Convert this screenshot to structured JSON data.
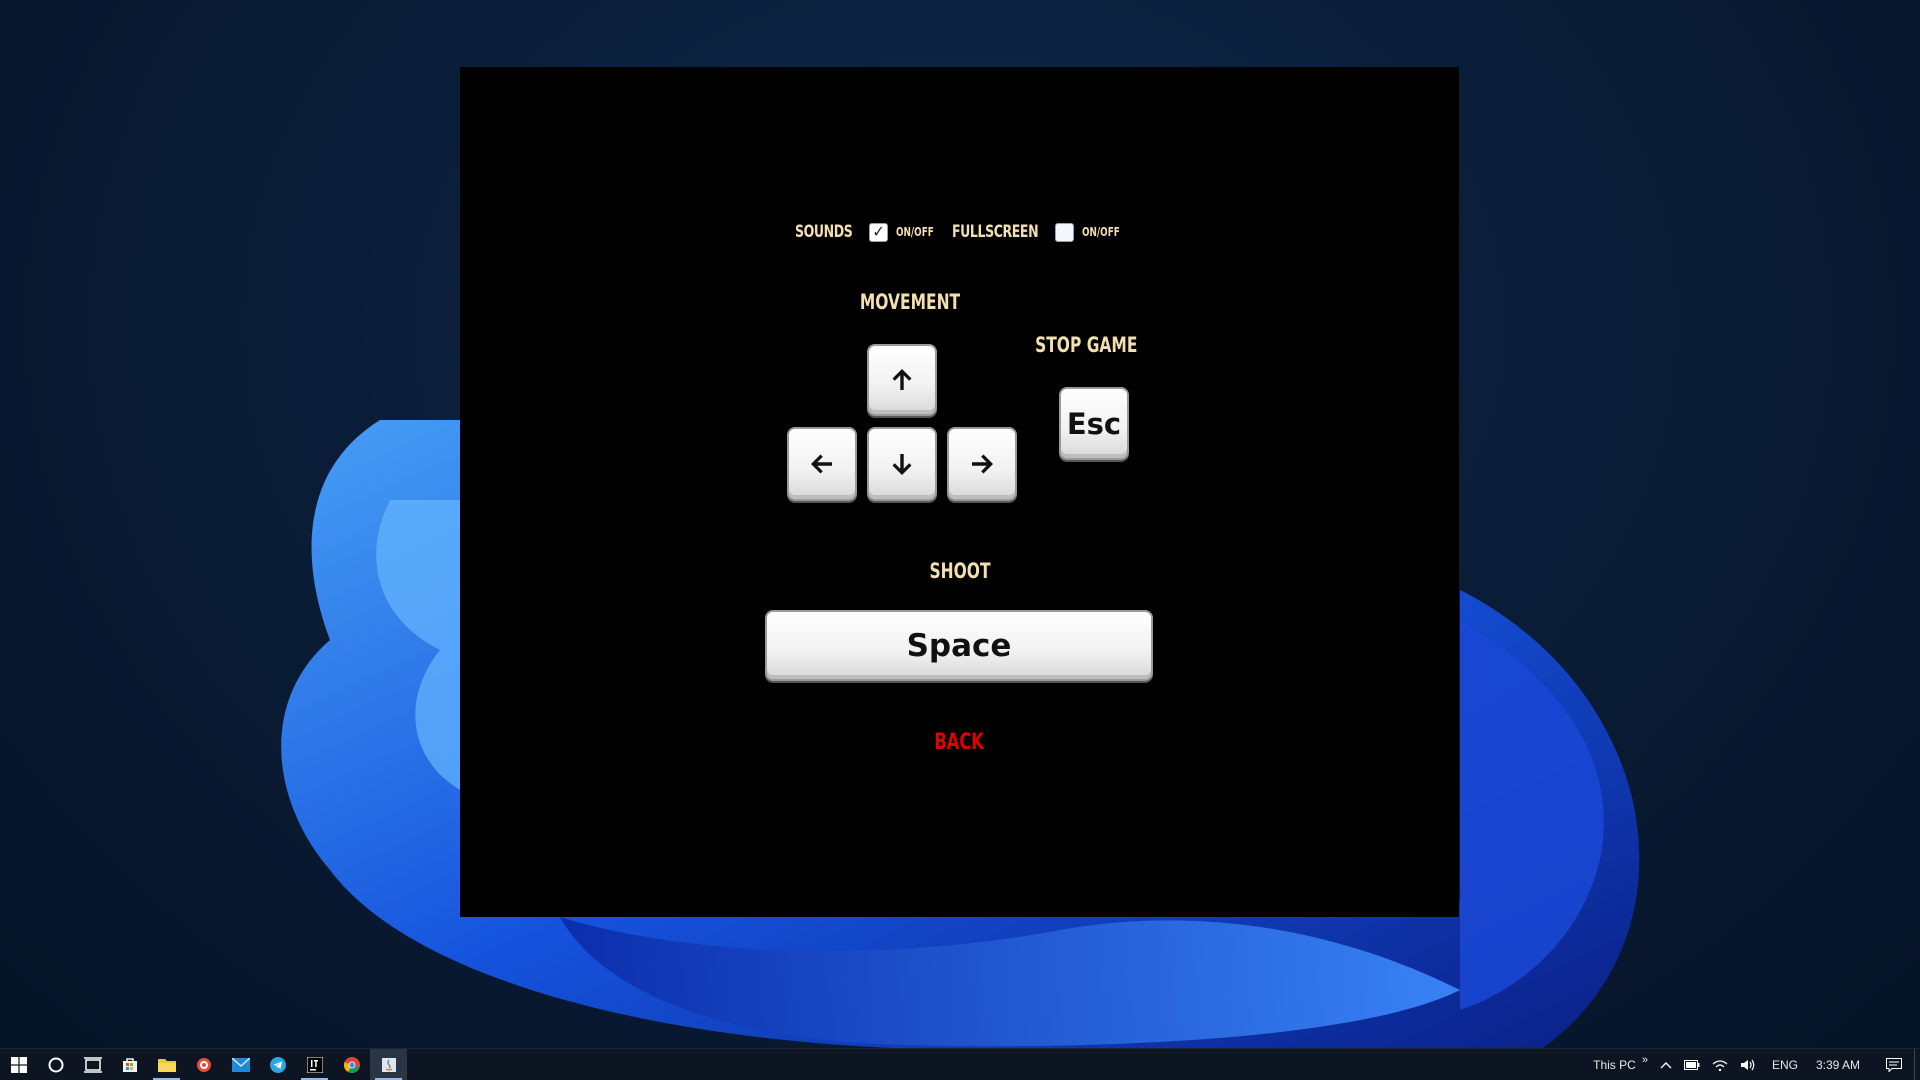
{
  "game": {
    "options": {
      "sounds_label": "SOUNDS",
      "sounds_toggle_label": "ON/OFF",
      "sounds_checked": true,
      "fullscreen_label": "FULLSCREEN",
      "fullscreen_toggle_label": "ON/OFF",
      "fullscreen_checked": false
    },
    "movement": {
      "heading": "MOVEMENT",
      "keys": [
        "up-arrow",
        "left-arrow",
        "down-arrow",
        "right-arrow"
      ]
    },
    "stop_game": {
      "heading": "STOP GAME",
      "key_label": "Esc"
    },
    "shoot": {
      "heading": "SHOOT",
      "key_label": "Space"
    },
    "back_label": "BACK",
    "colors": {
      "background": "#000000",
      "heading": "#f3dfb0",
      "back": "#e00000",
      "key_face": "#eeeeee"
    }
  },
  "taskbar": {
    "apps": [
      "windows-start-icon",
      "cortana-search-icon",
      "task-view-icon",
      "store-icon",
      "file-explorer-icon",
      "media-player-icon",
      "mail-icon",
      "telegram-icon",
      "intellij-icon",
      "chrome-icon",
      "java-app-icon"
    ],
    "tray": {
      "location_label": "This PC",
      "overflow": "»",
      "language": "ENG",
      "time": "3:39 AM"
    }
  }
}
